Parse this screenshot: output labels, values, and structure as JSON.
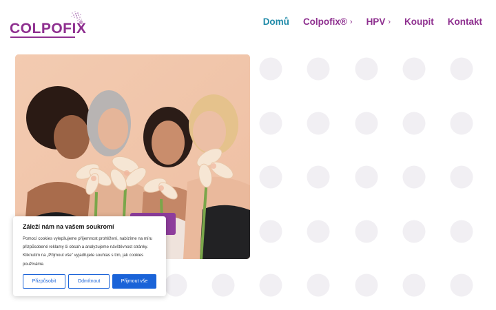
{
  "brand": {
    "logo_text": "COLPOFIX",
    "logo_reg": "®",
    "primary_color": "#8e2f8f",
    "accent_color": "#1f8aa8"
  },
  "nav": {
    "items": [
      {
        "label": "Domů",
        "active": true,
        "has_submenu": false
      },
      {
        "label": "Colpofix®",
        "active": false,
        "has_submenu": true
      },
      {
        "label": "HPV",
        "active": false,
        "has_submenu": true
      },
      {
        "label": "Koupit",
        "active": false,
        "has_submenu": false
      },
      {
        "label": "Kontakt",
        "active": false,
        "has_submenu": false
      }
    ],
    "chevron": "›"
  },
  "hero": {
    "image_icon": "women-with-flowers-photo",
    "promo_tag_text": "I"
  },
  "cookie_banner": {
    "title": "Záleží nám na vašem soukromí",
    "body": "Pomocí cookies vylepšujeme příjemnost prohlížení, nabízíme na míru přizpůsobené reklamy či obsah a analyzujeme návštěvnost stránky. Kliknutím na „Přijmout vše\" vyjadřujete souhlas s tím, jak cookies používáme.",
    "buttons": {
      "customize": "Přizpůsobit",
      "reject": "Odmítnout",
      "accept": "Přijmout vše"
    },
    "button_color": "#1a63d8"
  },
  "background": {
    "dot_color": "#f1eff3"
  }
}
